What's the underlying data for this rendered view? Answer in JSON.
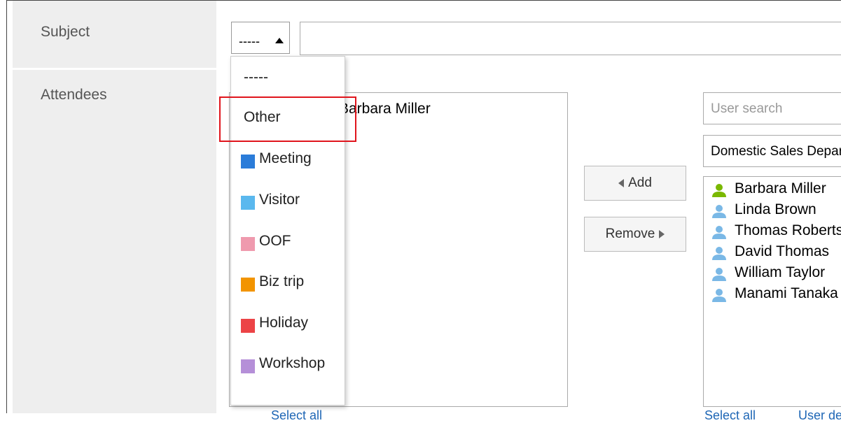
{
  "form": {
    "subject_label": "Subject",
    "attendees_label": "Attendees"
  },
  "subject": {
    "selected_value": "-----",
    "input_value": ""
  },
  "dropdown": {
    "options": [
      {
        "label": "-----",
        "color": null
      },
      {
        "label": "Other",
        "color": null
      },
      {
        "label": "Meeting",
        "color": "#2b7cd9"
      },
      {
        "label": "Visitor",
        "color": "#5ab8ee"
      },
      {
        "label": "OOF",
        "color": "#ef9aae"
      },
      {
        "label": "Biz trip",
        "color": "#f29400"
      },
      {
        "label": "Holiday",
        "color": "#ec4346"
      },
      {
        "label": "Workshop",
        "color": "#b58fd8"
      }
    ],
    "highlighted": "Other"
  },
  "attendees": {
    "selected": [
      "Barbara Miller"
    ],
    "select_all_label": "Select all"
  },
  "buttons": {
    "add_label": "Add",
    "remove_label": "Remove"
  },
  "search": {
    "user_search_placeholder": "User search",
    "group_value": "Domestic Sales Department"
  },
  "users": {
    "items": [
      {
        "name": "Barbara Miller",
        "icon": "user-icon-active",
        "color": "#7ab800"
      },
      {
        "name": "Linda Brown",
        "icon": "user-icon",
        "color": "#7ab8e6"
      },
      {
        "name": "Thomas Roberts",
        "icon": "user-icon",
        "color": "#7ab8e6"
      },
      {
        "name": "David Thomas",
        "icon": "user-icon",
        "color": "#7ab8e6"
      },
      {
        "name": "William Taylor",
        "icon": "user-icon",
        "color": "#7ab8e6"
      },
      {
        "name": "Manami Tanaka",
        "icon": "user-icon",
        "color": "#7ab8e6"
      }
    ],
    "select_all_label": "Select all",
    "user_details_label": "User details"
  }
}
